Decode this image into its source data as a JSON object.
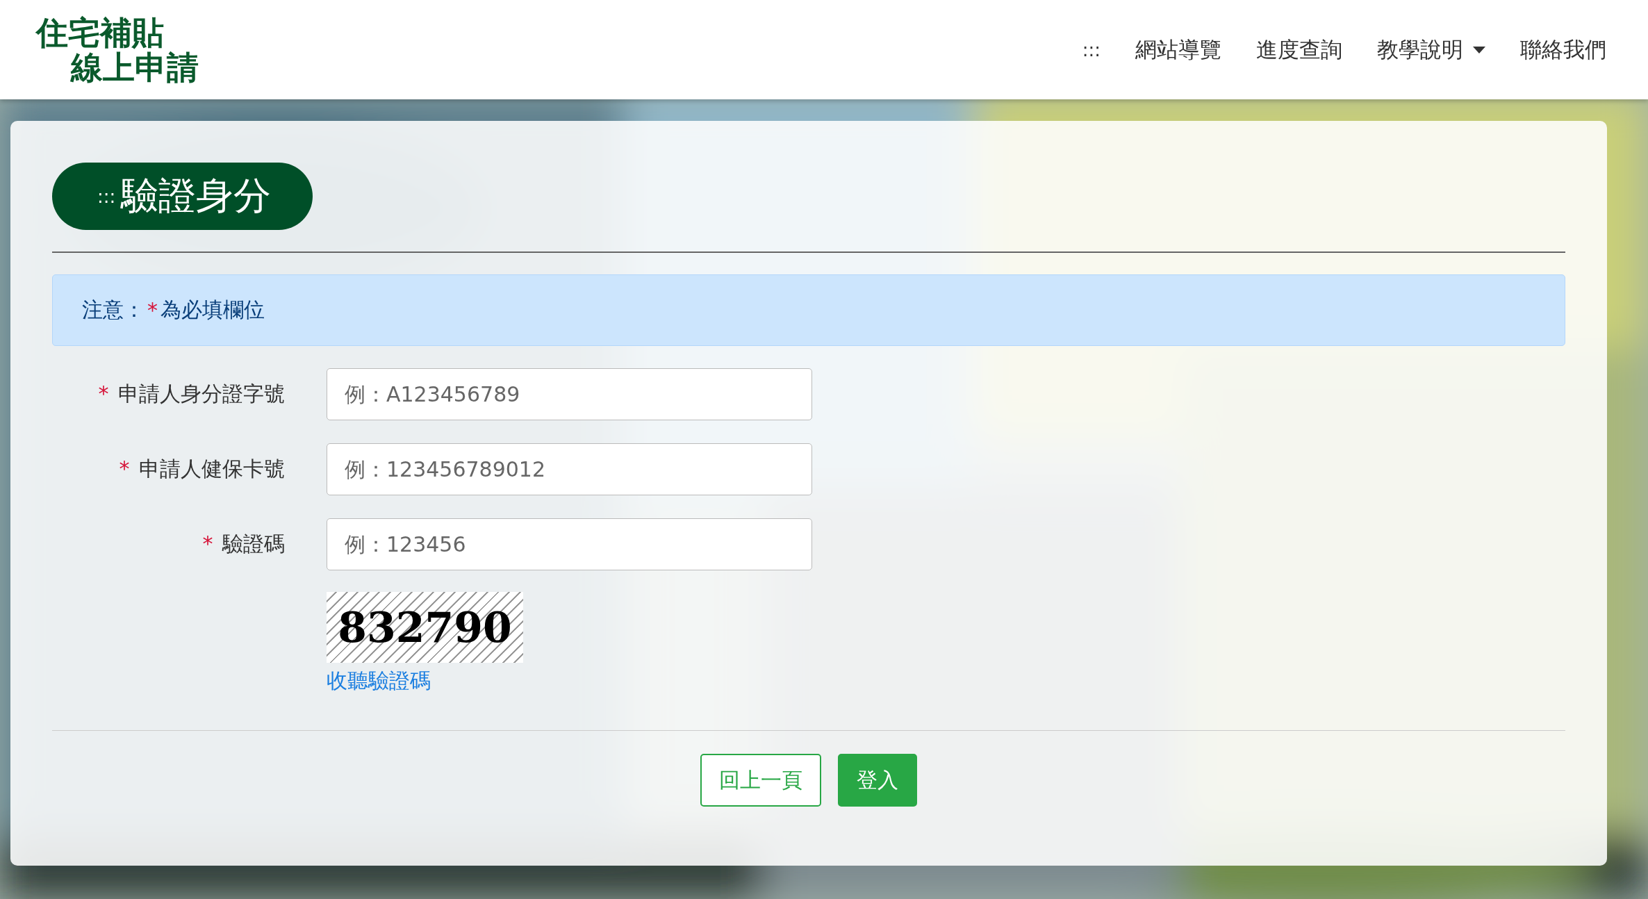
{
  "logo": {
    "line_1": "住宅補貼",
    "line_2": "線上申請"
  },
  "nav": {
    "accesskey": ":::",
    "items": [
      {
        "label": "網站導覽",
        "kind": "link"
      },
      {
        "label": "進度查詢",
        "kind": "link"
      },
      {
        "label": "教學說明",
        "kind": "dropdown"
      },
      {
        "label": "聯絡我們",
        "kind": "link"
      }
    ]
  },
  "panel": {
    "accesskey": ":::",
    "title": "驗證身分"
  },
  "notice": {
    "prefix": "注意：",
    "mark": "*",
    "text": "為必填欄位"
  },
  "fields": [
    {
      "mark": "*",
      "label": "申請人身分證字號",
      "placeholder": "例：A123456789"
    },
    {
      "mark": "*",
      "label": "申請人健保卡號",
      "placeholder": "例：123456789012"
    },
    {
      "mark": "*",
      "label": "驗證碼",
      "placeholder": "例：123456"
    }
  ],
  "captcha": {
    "code": "832790",
    "audio_link": "收聽驗證碼"
  },
  "buttons": [
    {
      "label": "回上一頁",
      "kind": "secondary"
    },
    {
      "label": "登入",
      "kind": "primary"
    }
  ]
}
